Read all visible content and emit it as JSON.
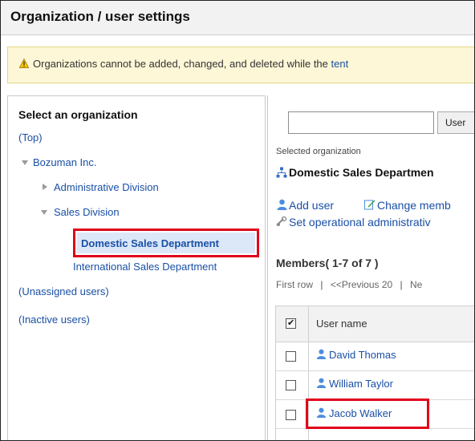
{
  "window": {
    "title": "Organization / user settings"
  },
  "notice": {
    "message": "Organizations cannot be added, changed, and deleted while the ",
    "link": "tent"
  },
  "left_pane": {
    "title": "Select an organization",
    "top_link": "(Top)",
    "company": "Bozuman Inc.",
    "administrative_division": "Administrative Division",
    "sales_division": "Sales Division",
    "selected_department": "Domestic Sales Department",
    "international_department": "International Sales Department",
    "unassigned_users": "(Unassigned users)",
    "inactive_users": "(Inactive users)"
  },
  "right_pane": {
    "search_value": "",
    "user_button": "User",
    "selected_org_label": "Selected organization",
    "selected_org_name": "Domestic Sales Departmen",
    "add_user": "Add user",
    "change_members": "Change memb",
    "set_operational_admin": "Set operational administrativ",
    "members_heading": "Members( 1-7 of 7 )",
    "pager": {
      "first_row": "First row",
      "separator": "|",
      "previous": "<<Previous 20",
      "next": "Ne"
    },
    "table": {
      "header": "User name",
      "rows": [
        "David Thomas",
        "William Taylor",
        "Jacob Walker"
      ]
    }
  },
  "colors": {
    "link": "#1a4fa6",
    "highlight_border": "#e0001b",
    "notice_bg": "#fdf7d7",
    "selected_bg": "#dce8f8"
  },
  "icons": [
    "warning-icon",
    "expand-arrow-icon",
    "collapse-arrow-icon",
    "organization-icon",
    "user-icon",
    "edit-icon",
    "settings-icon",
    "checkbox-icon"
  ]
}
